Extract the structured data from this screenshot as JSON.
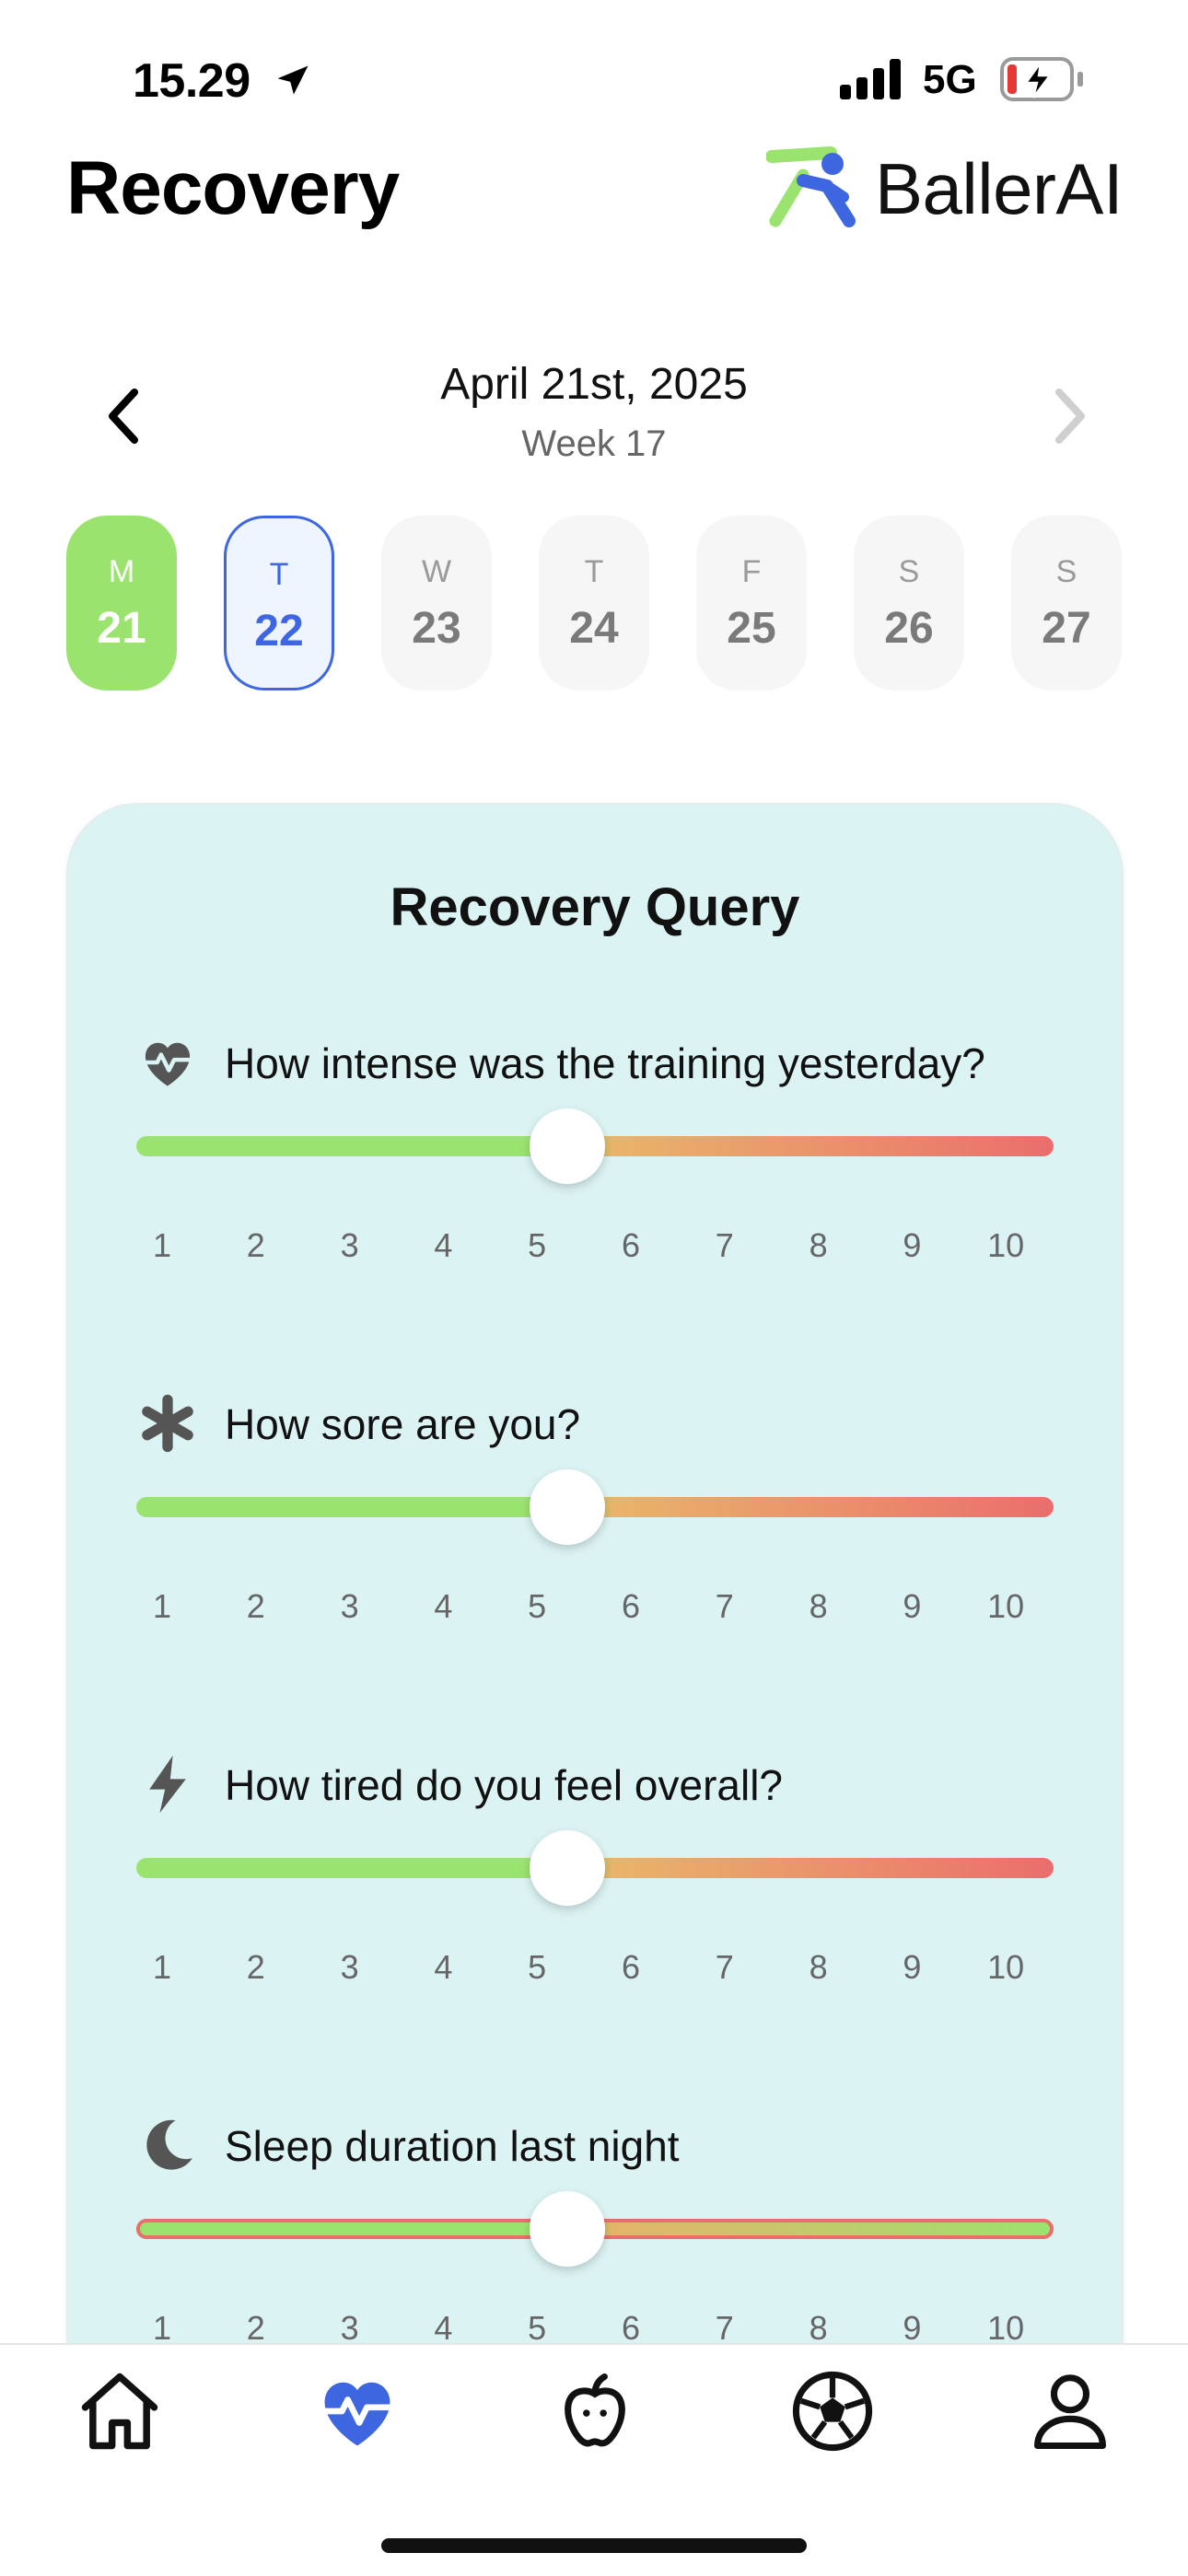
{
  "status_bar": {
    "time": "15.29",
    "network": "5G",
    "location_icon": "location-arrow-icon",
    "signal_icon": "signal-bars-icon",
    "battery_icon": "battery-charging-low-icon"
  },
  "header": {
    "title": "Recovery",
    "brand": "BallerAI",
    "logo_icon": "runner-logo-icon"
  },
  "date_nav": {
    "date": "April 21st, 2025",
    "week": "Week 17",
    "prev_icon": "chevron-left-icon",
    "next_icon": "chevron-right-icon"
  },
  "days": [
    {
      "letter": "M",
      "number": "21",
      "state": "done"
    },
    {
      "letter": "T",
      "number": "22",
      "state": "selected"
    },
    {
      "letter": "W",
      "number": "23",
      "state": "default"
    },
    {
      "letter": "T",
      "number": "24",
      "state": "default"
    },
    {
      "letter": "F",
      "number": "25",
      "state": "default"
    },
    {
      "letter": "S",
      "number": "26",
      "state": "default"
    },
    {
      "letter": "S",
      "number": "27",
      "state": "default"
    }
  ],
  "card": {
    "title": "Recovery Query",
    "questions": [
      {
        "text": "How intense was the training yesterday?",
        "icon": "heart-pulse-icon",
        "value": 5
      },
      {
        "text": "How sore are you?",
        "icon": "asterisk-icon",
        "value": 5
      },
      {
        "text": "How tired do you feel overall?",
        "icon": "lightning-bolt-icon",
        "value": 5
      },
      {
        "text": "Sleep duration last night",
        "icon": "moon-icon",
        "value": 5
      }
    ],
    "scale": [
      "1",
      "2",
      "3",
      "4",
      "5",
      "6",
      "7",
      "8",
      "9",
      "10"
    ]
  },
  "tabbar": {
    "items": [
      {
        "name": "home",
        "icon": "home-icon",
        "active": false
      },
      {
        "name": "recovery",
        "icon": "heart-pulse-icon",
        "active": true
      },
      {
        "name": "nutrition",
        "icon": "apple-icon",
        "active": false
      },
      {
        "name": "training",
        "icon": "soccer-ball-icon",
        "active": false
      },
      {
        "name": "profile",
        "icon": "person-icon",
        "active": false
      }
    ]
  },
  "colors": {
    "accent_blue": "#3d66e0",
    "done_green": "#9be36f",
    "card_bg": "#dcf3f4",
    "slider_red": "#ea6e6c"
  }
}
